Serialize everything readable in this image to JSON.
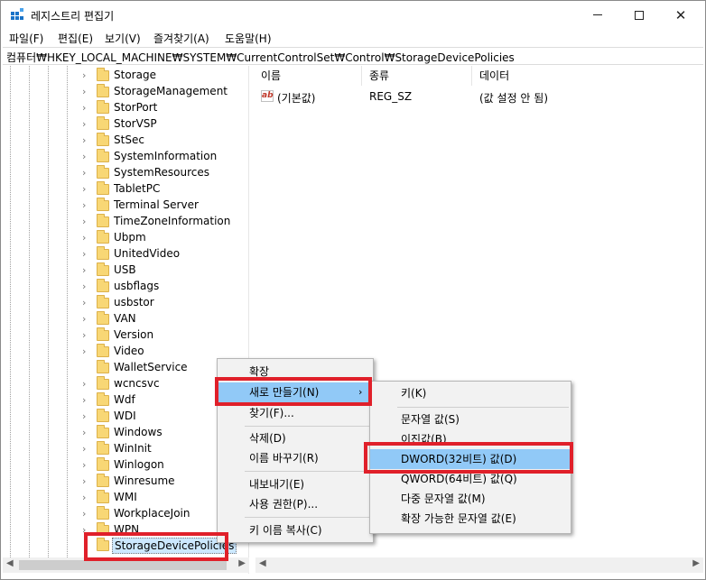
{
  "window": {
    "title": "레지스트리 편집기",
    "min_glyph": "",
    "max_glyph": "",
    "close_glyph": "✕"
  },
  "menu": {
    "items": [
      "파일(F)",
      "편집(E)",
      "보기(V)",
      "즐겨찾기(A)",
      "도움말(H)"
    ]
  },
  "address": {
    "path": "컴퓨터₩HKEY_LOCAL_MACHINE₩SYSTEM₩CurrentControlSet₩Control₩StorageDevicePolicies"
  },
  "tree": {
    "items": [
      {
        "label": "Storage",
        "expandable": true
      },
      {
        "label": "StorageManagement",
        "expandable": true
      },
      {
        "label": "StorPort",
        "expandable": true
      },
      {
        "label": "StorVSP",
        "expandable": true
      },
      {
        "label": "StSec",
        "expandable": true
      },
      {
        "label": "SystemInformation",
        "expandable": true
      },
      {
        "label": "SystemResources",
        "expandable": true
      },
      {
        "label": "TabletPC",
        "expandable": true
      },
      {
        "label": "Terminal Server",
        "expandable": true
      },
      {
        "label": "TimeZoneInformation",
        "expandable": true
      },
      {
        "label": "Ubpm",
        "expandable": true
      },
      {
        "label": "UnitedVideo",
        "expandable": true
      },
      {
        "label": "USB",
        "expandable": true
      },
      {
        "label": "usbflags",
        "expandable": true
      },
      {
        "label": "usbstor",
        "expandable": true
      },
      {
        "label": "VAN",
        "expandable": true
      },
      {
        "label": "Version",
        "expandable": true
      },
      {
        "label": "Video",
        "expandable": true
      },
      {
        "label": "WalletService",
        "expandable": false
      },
      {
        "label": "wcncsvc",
        "expandable": true
      },
      {
        "label": "Wdf",
        "expandable": true
      },
      {
        "label": "WDI",
        "expandable": true
      },
      {
        "label": "Windows",
        "expandable": true
      },
      {
        "label": "WinInit",
        "expandable": true
      },
      {
        "label": "Winlogon",
        "expandable": true
      },
      {
        "label": "Winresume",
        "expandable": true
      },
      {
        "label": "WMI",
        "expandable": true
      },
      {
        "label": "WorkplaceJoin",
        "expandable": true
      },
      {
        "label": "WPN",
        "expandable": true
      },
      {
        "label": "StorageDevicePolicies",
        "expandable": false,
        "selected": true
      }
    ]
  },
  "values": {
    "columns": [
      "이름",
      "종류",
      "데이터"
    ],
    "rows": [
      {
        "name": "(기본값)",
        "type": "REG_SZ",
        "data": "(값 설정 안 됨)",
        "icon": "ab"
      }
    ]
  },
  "context_menu": {
    "items": [
      {
        "label": "확장"
      },
      {
        "label": "새로 만들기(N)",
        "submenu_arrow": "›"
      },
      {
        "label": "찾기(F)..."
      },
      {
        "label": "삭제(D)"
      },
      {
        "label": "이름 바꾸기(R)"
      },
      {
        "label": "내보내기(E)"
      },
      {
        "label": "사용 권한(P)..."
      },
      {
        "label": "키 이름 복사(C)"
      }
    ]
  },
  "submenu": {
    "items": [
      {
        "label": "키(K)"
      },
      {
        "label": "문자열 값(S)"
      },
      {
        "label": "이진값(B)"
      },
      {
        "label": "DWORD(32비트) 값(D)"
      },
      {
        "label": "QWORD(64비트) 값(Q)"
      },
      {
        "label": "다중 문자열 값(M)"
      },
      {
        "label": "확장 가능한 문자열 값(E)"
      }
    ]
  },
  "colors": {
    "highlight_box": "#e0202a",
    "menu_highlight": "#91c9f7",
    "folder": "#f8d775"
  }
}
